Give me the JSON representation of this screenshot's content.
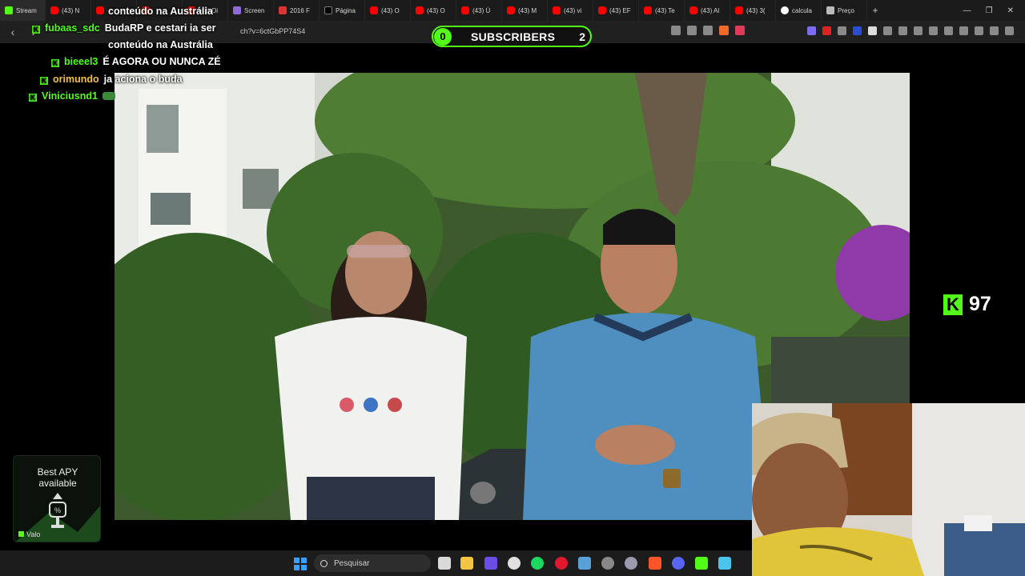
{
  "browser": {
    "tabs": [
      {
        "label": "Stream",
        "icon": "kick-icon"
      },
      {
        "label": "(43) N",
        "icon": "youtube-icon"
      },
      {
        "label": "",
        "icon": "youtube-icon"
      },
      {
        "label": "",
        "icon": "youtube-icon"
      },
      {
        "label": "(43) Di",
        "icon": "youtube-icon"
      },
      {
        "label": "Screen",
        "icon": "pen-icon"
      },
      {
        "label": "2016 F",
        "icon": "car-icon"
      },
      {
        "label": "Página",
        "icon": "x-icon"
      },
      {
        "label": "(43) O",
        "icon": "youtube-icon"
      },
      {
        "label": "(43) O",
        "icon": "youtube-icon"
      },
      {
        "label": "(43) Ú",
        "icon": "youtube-icon"
      },
      {
        "label": "(43) M",
        "icon": "youtube-icon"
      },
      {
        "label": "(43) vi",
        "icon": "youtube-icon"
      },
      {
        "label": "(43) EF",
        "icon": "youtube-icon"
      },
      {
        "label": "(43) Te",
        "icon": "youtube-icon"
      },
      {
        "label": "(43) Al",
        "icon": "youtube-icon"
      },
      {
        "label": "(43) 3(",
        "icon": "youtube-icon"
      },
      {
        "label": "calcula",
        "icon": "google-icon"
      },
      {
        "label": "Preço",
        "icon": "page-icon"
      }
    ],
    "new_tab": "+",
    "url": "ch?v=6ctGbPP74S4"
  },
  "overlay": {
    "subscribers": {
      "left_count": "0",
      "label": "SUBSCRIBERS",
      "right_count": "2"
    },
    "chat": [
      {
        "user": "",
        "text": "conteúdo na Austrália",
        "color": "#ffffff"
      },
      {
        "user": "fubaas_sdc",
        "text": "BudaRP e cestari ia ser",
        "color": "#53fc18"
      },
      {
        "user": "",
        "text": "conteúdo na Austrália",
        "color": "#ffffff"
      },
      {
        "user": "bieeel3",
        "text": "É AGORA OU NUNCA ZÉ",
        "color": "#53fc18"
      },
      {
        "user": "orimundo",
        "text": "ja aciona o buda",
        "color": "#f0c040"
      },
      {
        "user": "Viniciusnd1",
        "text": "",
        "color": "#53fc18"
      }
    ],
    "kick_count": "97",
    "ad": {
      "title_line1": "Best APY",
      "title_line2": "available",
      "footer": "Valo"
    }
  },
  "taskbar": {
    "search_placeholder": "Pesquisar"
  },
  "colors": {
    "kick_green": "#53fc18",
    "tab_bg": "#1b1b1b",
    "addr_bg": "#202020",
    "taskbar_bg": "#1c1c1c"
  }
}
